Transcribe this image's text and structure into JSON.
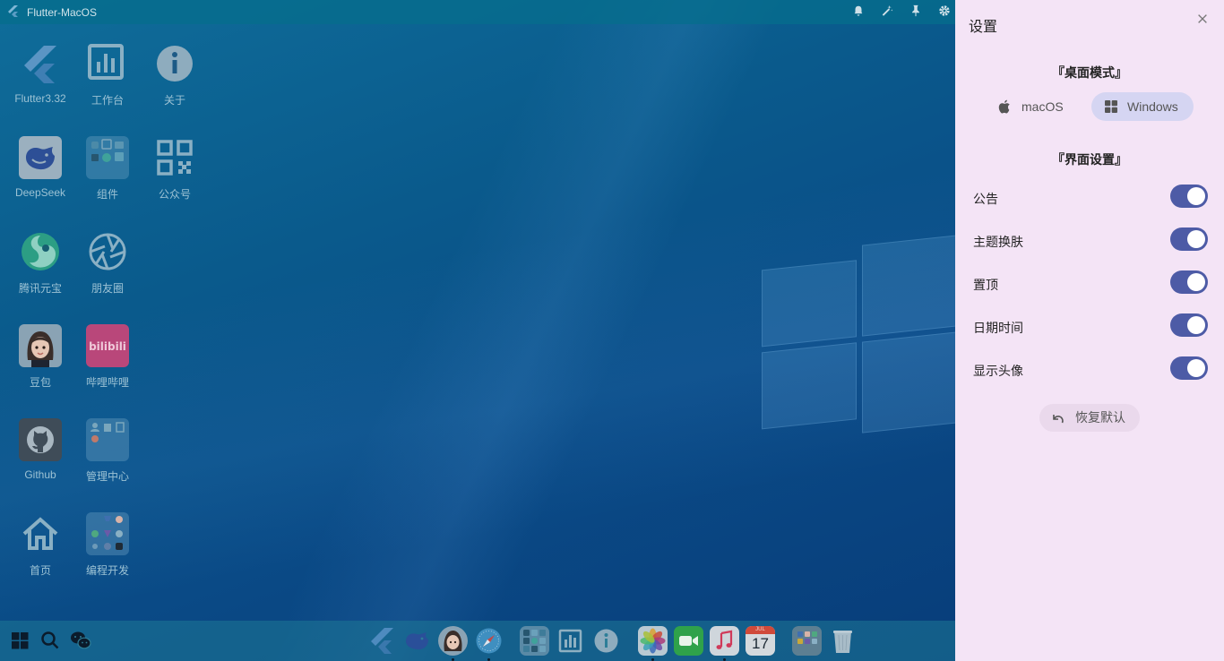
{
  "window": {
    "title": "Flutter-MacOS"
  },
  "titlebar_icons": [
    "bell-icon",
    "magic-wand-icon",
    "pin-icon",
    "gear-icon"
  ],
  "desktop": {
    "icons": [
      {
        "label": "Flutter3.32",
        "icon": "flutter-icon"
      },
      {
        "label": "工作台",
        "icon": "bar-chart-icon"
      },
      {
        "label": "关于",
        "icon": "info-icon"
      },
      {
        "label": "DeepSeek",
        "icon": "deepseek-icon"
      },
      {
        "label": "组件",
        "icon": "widgets-folder-icon"
      },
      {
        "label": "公众号",
        "icon": "qrcode-icon"
      },
      {
        "label": "腾讯元宝",
        "icon": "yuanbao-icon"
      },
      {
        "label": "朋友圈",
        "icon": "aperture-icon"
      },
      {
        "label": "豆包",
        "icon": "doubao-avatar-icon"
      },
      {
        "label": "哔哩哔哩",
        "icon": "bilibili-icon"
      },
      {
        "label": "Github",
        "icon": "github-icon"
      },
      {
        "label": "管理中心",
        "icon": "admin-folder-icon"
      },
      {
        "label": "首页",
        "icon": "home-icon"
      },
      {
        "label": "编程开发",
        "icon": "dev-folder-icon"
      }
    ]
  },
  "taskbar": {
    "left": [
      "windows-start-icon",
      "search-icon",
      "wechat-icon"
    ],
    "dock": [
      "flutter-icon",
      "deepseek-icon",
      "doubao-avatar-icon",
      "safari-icon",
      "widgets-folder-icon",
      "bar-chart-icon",
      "info-icon",
      "photos-icon",
      "facetime-icon",
      "music-icon",
      "calendar-icon",
      "apps-folder-icon",
      "trash-icon"
    ],
    "calendar": {
      "month": "JUL",
      "day": "17"
    }
  },
  "panel": {
    "title": "设置",
    "desktop_mode_title": "『桌面模式』",
    "modes": [
      {
        "label": "macOS",
        "icon": "apple-icon",
        "active": false
      },
      {
        "label": "Windows",
        "icon": "windows-icon",
        "active": true
      }
    ],
    "ui_settings_title": "『界面设置』",
    "settings": [
      {
        "label": "公告",
        "on": true
      },
      {
        "label": "主题换肤",
        "on": true
      },
      {
        "label": "置顶",
        "on": true
      },
      {
        "label": "日期时间",
        "on": true
      },
      {
        "label": "显示头像",
        "on": true
      }
    ],
    "reset_label": "恢复默认"
  },
  "colors": {
    "accent": "#4d5ba6",
    "panel_bg": "#f4e4f6",
    "mode_active_bg": "#d5d5f2"
  }
}
